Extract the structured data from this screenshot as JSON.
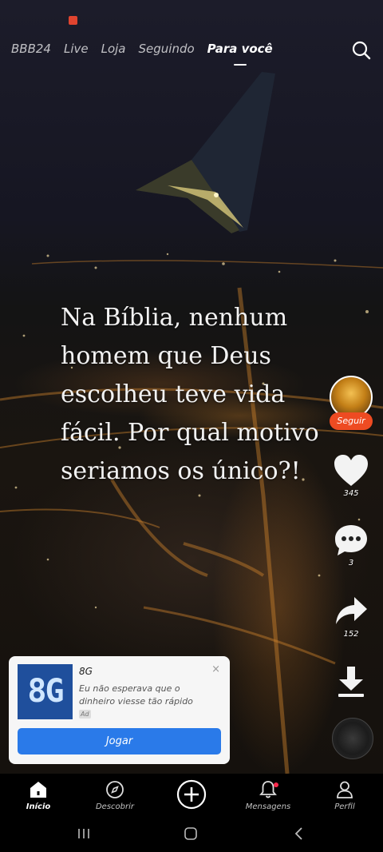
{
  "top_tabs": [
    {
      "label": "BBB24",
      "active": false
    },
    {
      "label": "Live",
      "active": false
    },
    {
      "label": "Loja",
      "active": false
    },
    {
      "label": "Seguindo",
      "active": false
    },
    {
      "label": "Para você",
      "active": true
    }
  ],
  "icons": {
    "search": "search-icon",
    "like": "heart-icon",
    "comment": "comment-icon",
    "share": "share-arrow-icon",
    "download": "download-icon"
  },
  "caption": "Na Bíblia, nenhum homem que Deus escolheu teve vida fácil. Por qual motivo seriamos os único?!",
  "creator": {
    "follow_label": "Seguir"
  },
  "actions": {
    "likes": "345",
    "comments": "3",
    "shares": "152"
  },
  "ad": {
    "logo_text": "8G",
    "title": "8G",
    "description": "Eu não esperava que o dinheiro viesse tão rápido",
    "tag": "Ad",
    "close": "×",
    "cta": "Jogar"
  },
  "bottom_nav": [
    {
      "label": "Início",
      "icon": "home-icon",
      "active": true
    },
    {
      "label": "Descobrir",
      "icon": "compass-icon",
      "active": false
    },
    {
      "label": "",
      "icon": "create-plus-icon",
      "active": false
    },
    {
      "label": "Mensagens",
      "icon": "bell-icon",
      "active": false
    },
    {
      "label": "Perfil",
      "icon": "person-icon",
      "active": false
    }
  ],
  "colors": {
    "follow": "#ee4b22",
    "cta": "#2a7ae9",
    "notification_dot": "#ff2a4d"
  }
}
